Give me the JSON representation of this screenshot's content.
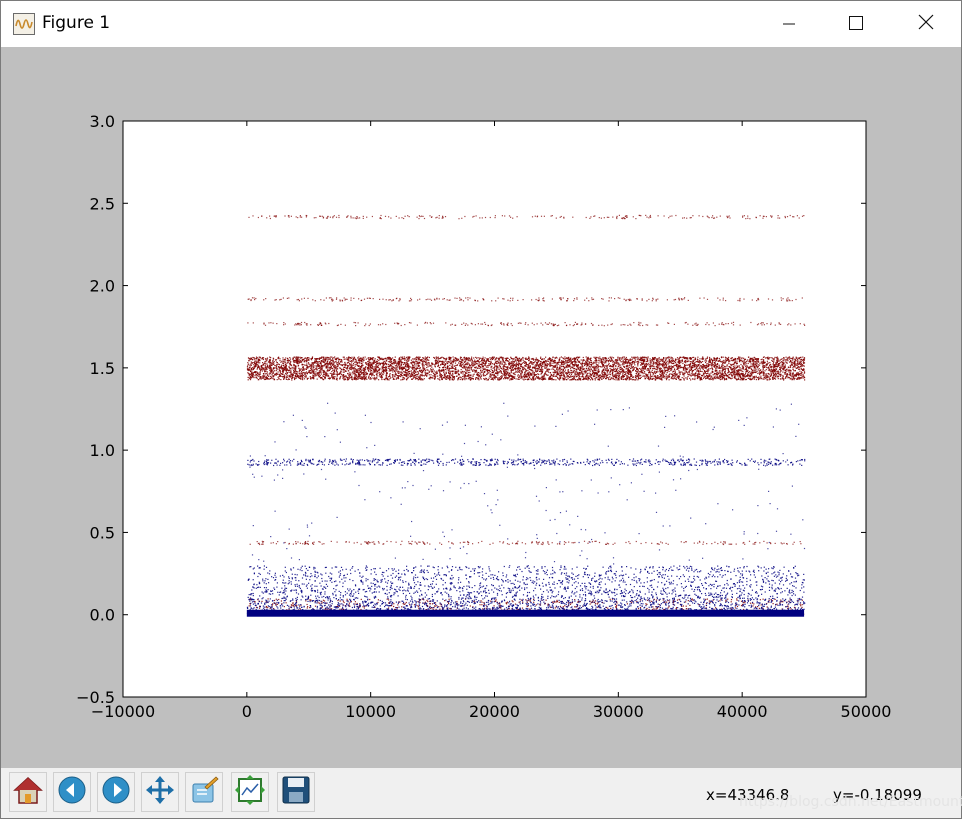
{
  "window": {
    "title": "Figure 1",
    "app_icon": "matplotlib-figure-icon",
    "minimize_icon": "minimize-icon",
    "maximize_icon": "maximize-icon",
    "close_icon": "close-icon"
  },
  "colors": {
    "canvas_background": "#bfbfbf",
    "plot_background": "#ffffff",
    "series_red": "#800000",
    "series_blue": "#000080"
  },
  "chart_data": {
    "type": "scatter",
    "title": "",
    "xlabel": "",
    "ylabel": "",
    "xlim": [
      -10000,
      50000
    ],
    "ylim": [
      -0.5,
      3.0
    ],
    "x_ticks": [
      "−10000",
      "0",
      "10000",
      "20000",
      "30000",
      "40000",
      "50000"
    ],
    "y_ticks": [
      "−0.5",
      "0.0",
      "0.5",
      "1.0",
      "1.5",
      "2.0",
      "2.5",
      "3.0"
    ],
    "grid": false,
    "legend": "none",
    "x_range": [
      0,
      45000
    ],
    "series": [
      {
        "color": "#800000",
        "bands": [
          {
            "y": [
              1.43,
              1.57
            ],
            "density": "very dense"
          },
          {
            "y": [
              2.41,
              2.43
            ],
            "density": "sparse"
          },
          {
            "y": [
              1.91,
              1.93
            ],
            "density": "sparse"
          },
          {
            "y": [
              1.76,
              1.78
            ],
            "density": "sparse"
          },
          {
            "y": [
              0.43,
              0.45
            ],
            "density": "sparse"
          },
          {
            "y": [
              0.0,
              0.1
            ],
            "density": "moderate"
          }
        ]
      },
      {
        "color": "#000080",
        "bands": [
          {
            "y": [
              0.0,
              0.03
            ],
            "density": "solid"
          },
          {
            "y": [
              0.0,
              0.3
            ],
            "density": "dense"
          },
          {
            "y": [
              0.3,
              1.3
            ],
            "density": "sparse"
          },
          {
            "y": [
              0.91,
              0.95
            ],
            "density": "moderate"
          }
        ]
      }
    ]
  },
  "toolbar": {
    "buttons": [
      {
        "name": "home-button",
        "icon": "home-icon"
      },
      {
        "name": "back-button",
        "icon": "back-arrow-icon"
      },
      {
        "name": "forward-button",
        "icon": "forward-arrow-icon"
      },
      {
        "name": "pan-button",
        "icon": "pan-move-icon"
      },
      {
        "name": "zoom-button",
        "icon": "zoom-rect-icon"
      },
      {
        "name": "subplots-button",
        "icon": "subplots-config-icon"
      },
      {
        "name": "save-button",
        "icon": "save-disk-icon"
      }
    ],
    "x_readout": "x=43346.8",
    "y_readout": "y=-0.18099",
    "watermark": "https://blog.csdn.net/Eastmount"
  }
}
